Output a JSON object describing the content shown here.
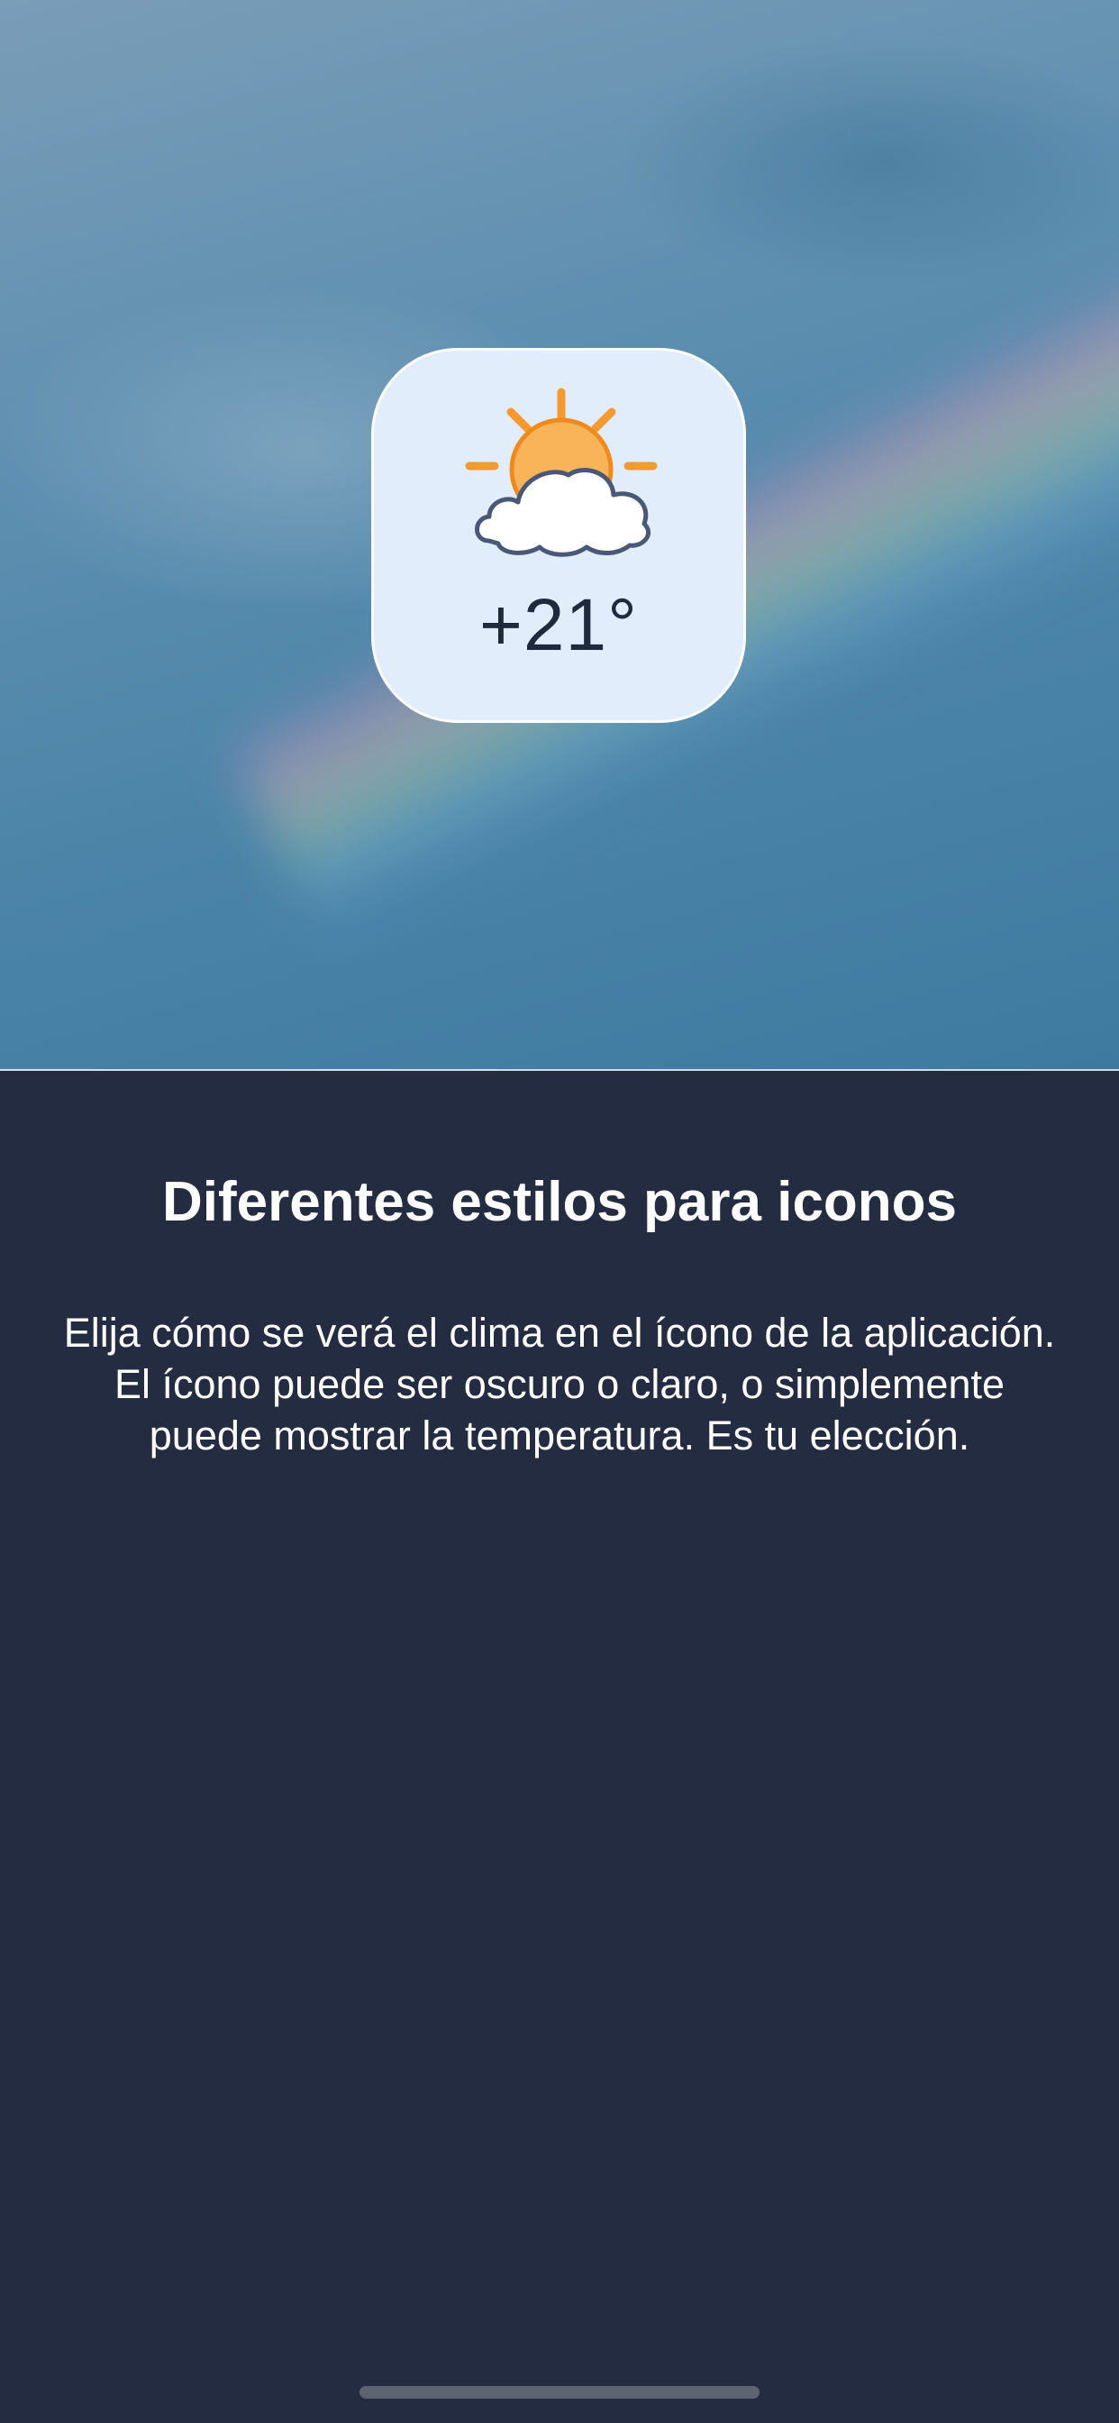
{
  "icon_preview": {
    "icon": "sun-behind-cloud-icon",
    "temperature": "+21°"
  },
  "onboarding": {
    "title": "Diferentes estilos para iconos",
    "description": "Elija cómo se verá el clima en el ícono de la aplicación. El ícono puede ser oscuro o claro, o simplemente puede mostrar la temperatura. Es tu elección."
  },
  "colors": {
    "background": "#232c40",
    "icon_tile": "#e1edfb",
    "sun": "#f7a84a",
    "sun_rays": "#f59a2f",
    "cloud_outline": "#4a5878"
  }
}
